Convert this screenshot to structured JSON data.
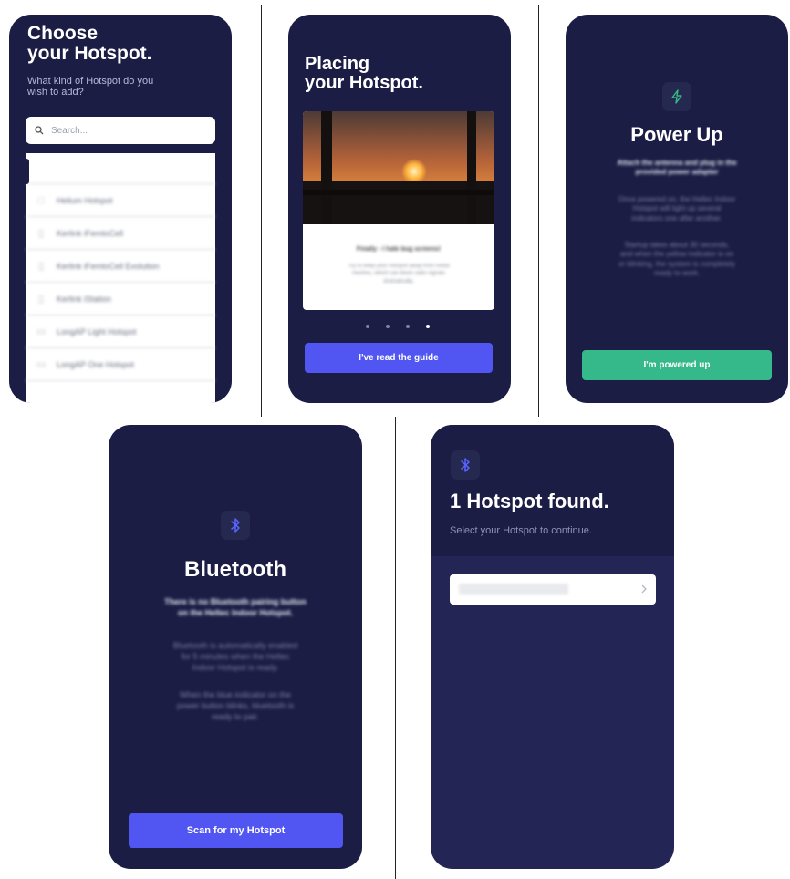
{
  "screen1": {
    "title_line1": "Choose",
    "title_line2": "your Hotspot.",
    "subtitle_line1": "What kind of Hotspot do you",
    "subtitle_line2": "wish to add?",
    "search_placeholder": "Search...",
    "items": [
      {
        "label": "",
        "icon": "blank"
      },
      {
        "label": "Helium Hotspot",
        "icon": "square-icon"
      },
      {
        "label": "Kerlink iFemtoCell",
        "icon": "antenna-icon"
      },
      {
        "label": "Kerlink iFemtoCell Evolution",
        "icon": "antenna-icon"
      },
      {
        "label": "Kerlink iStation",
        "icon": "antenna-icon"
      },
      {
        "label": "LongAP Light Hotspot",
        "icon": "device-icon"
      },
      {
        "label": "LongAP One Hotspot",
        "icon": "device-icon"
      }
    ]
  },
  "screen2": {
    "title_line1": "Placing",
    "title_line2": "your Hotspot.",
    "card_title": "Finally - I hate bug screens!",
    "card_body_line1": "Try to keep your Hotspot away from metal",
    "card_body_line2": "meshes, which can block radio signals",
    "card_body_line3": "dramatically.",
    "button": "I've read the guide",
    "pages": 4,
    "active_page": 4
  },
  "screen3": {
    "title": "Power Up",
    "bold_line1": "Attach the antenna and plug in the",
    "bold_line2": "provided power adapter",
    "para1_line1": "Once powered on, the Heltec Indoor",
    "para1_line2": "Hotspot will light up several",
    "para1_line3": "indicators one after another.",
    "para2_line1": "Startup takes about 30 seconds,",
    "para2_line2": "and when the yellow indicator is on",
    "para2_line3": "or blinking, the system is completely",
    "para2_line4": "ready to work.",
    "button": "I'm powered up",
    "icon": "lightning-icon"
  },
  "screen4": {
    "title": "Bluetooth",
    "bold_line1": "There is no Bluetooth pairing button",
    "bold_line2": "on the Heltec Indoor Hotspot.",
    "para1_line1": "Bluetooth is automatically enabled",
    "para1_line2": "for 5 minutes when the Heltec",
    "para1_line3": "Indoor Hotspot is ready.",
    "para2_line1": "When the blue indicator on the",
    "para2_line2": "power button blinks, bluetooth is",
    "para2_line3": "ready to pair.",
    "button": "Scan for my Hotspot",
    "icon": "bluetooth-icon"
  },
  "screen5": {
    "title": "1 Hotspot found.",
    "subtitle": "Select your Hotspot to continue.",
    "icon": "bluetooth-icon",
    "result_label": ""
  },
  "colors": {
    "phone_bg": "#1b1d45",
    "accent_blue": "#5156f2",
    "accent_green": "#36b98a",
    "bluetooth_blue": "#5a64ff"
  }
}
